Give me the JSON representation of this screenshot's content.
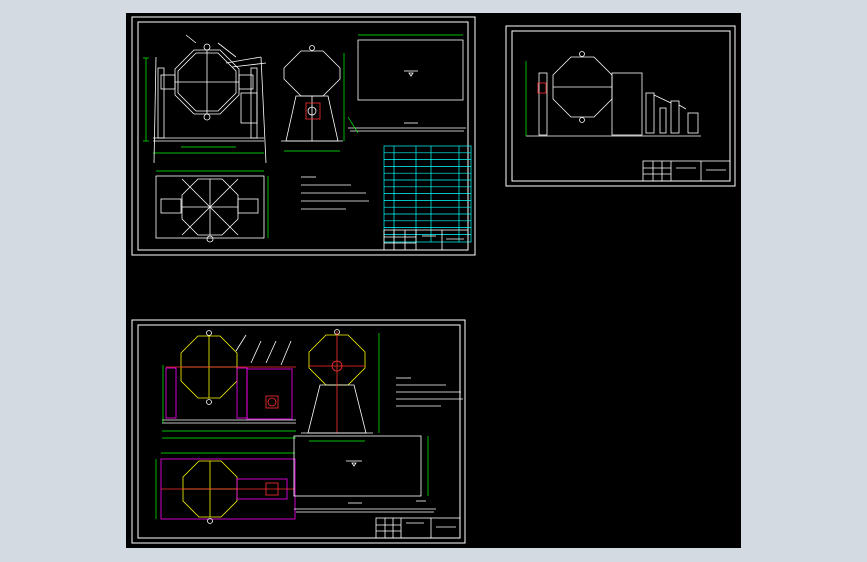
{
  "sheets": [
    {
      "id": "sheet-1",
      "title_block": {
        "name": "",
        "code": ""
      }
    },
    {
      "id": "sheet-2",
      "title_block": {
        "name": "",
        "code": ""
      }
    },
    {
      "id": "sheet-3",
      "title_block": {
        "name": "",
        "code": ""
      }
    }
  ],
  "colors": {
    "background": "#000000",
    "frame": "#ffffff",
    "dimension": "#00ff00",
    "table": "#00ffff",
    "vessel": "#ffff00",
    "frame_steel": "#ff00ff",
    "centerline": "#ff3030",
    "ui_chrome": "#d4dae2"
  }
}
